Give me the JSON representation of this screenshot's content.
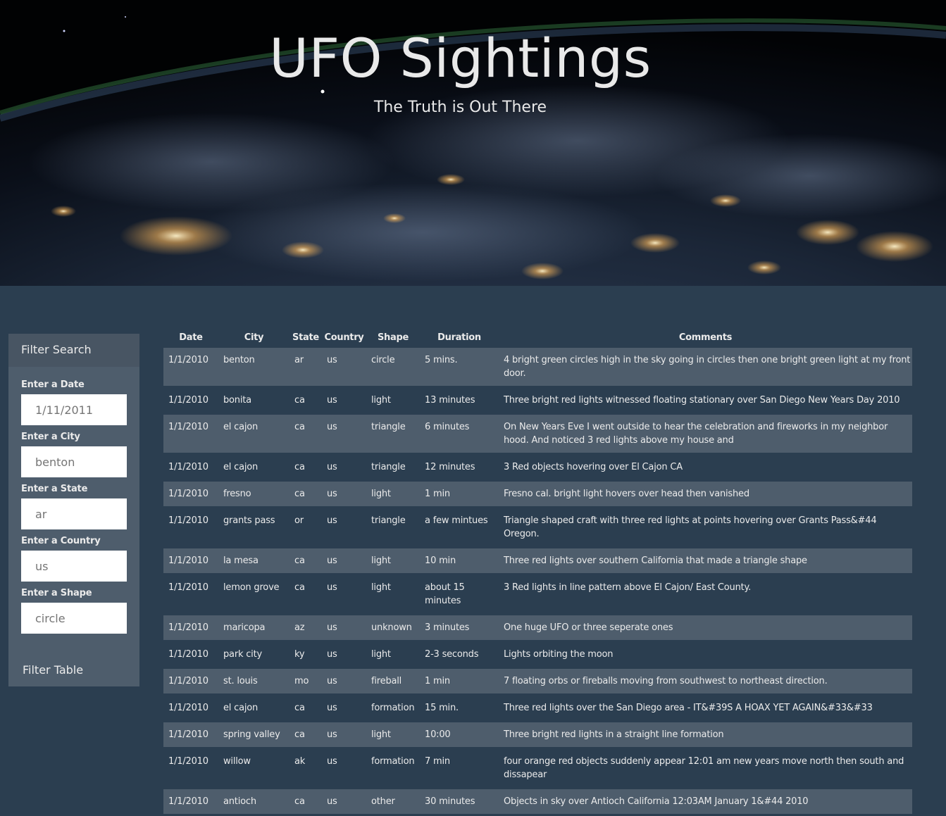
{
  "header": {
    "title": "UFO Sightings",
    "subtitle": "The Truth is Out There"
  },
  "filter": {
    "heading": "Filter Search",
    "fields": [
      {
        "label": "Enter a Date",
        "placeholder": "1/11/2011"
      },
      {
        "label": "Enter a City",
        "placeholder": "benton"
      },
      {
        "label": "Enter a State",
        "placeholder": "ar"
      },
      {
        "label": "Enter a Country",
        "placeholder": "us"
      },
      {
        "label": "Enter a Shape",
        "placeholder": "circle"
      }
    ],
    "button_label": "Filter Table"
  },
  "table": {
    "columns": [
      "Date",
      "City",
      "State",
      "Country",
      "Shape",
      "Duration",
      "Comments"
    ],
    "rows": [
      [
        "1/1/2010",
        "benton",
        "ar",
        "us",
        "circle",
        "5 mins.",
        "4 bright green circles high in the sky going in circles then one bright green light at my front door."
      ],
      [
        "1/1/2010",
        "bonita",
        "ca",
        "us",
        "light",
        "13 minutes",
        "Three bright red lights witnessed floating stationary over San Diego New Years Day 2010"
      ],
      [
        "1/1/2010",
        "el cajon",
        "ca",
        "us",
        "triangle",
        "6 minutes",
        "On New Years Eve I went outside to hear the celebration and fireworks in my neighbor hood. And noticed 3 red lights above my house and"
      ],
      [
        "1/1/2010",
        "el cajon",
        "ca",
        "us",
        "triangle",
        "12 minutes",
        "3 Red objects hovering over El Cajon CA"
      ],
      [
        "1/1/2010",
        "fresno",
        "ca",
        "us",
        "light",
        "1 min",
        "Fresno cal. bright light hovers over head then vanished"
      ],
      [
        "1/1/2010",
        "grants pass",
        "or",
        "us",
        "triangle",
        "a few mintues",
        "Triangle shaped craft with three red lights at points hovering over Grants Pass&#44 Oregon."
      ],
      [
        "1/1/2010",
        "la mesa",
        "ca",
        "us",
        "light",
        "10 min",
        "Three red lights over southern California that made a triangle shape"
      ],
      [
        "1/1/2010",
        "lemon grove",
        "ca",
        "us",
        "light",
        "about 15 minutes",
        "3 Red lights in line pattern above El Cajon/ East County."
      ],
      [
        "1/1/2010",
        "maricopa",
        "az",
        "us",
        "unknown",
        "3 minutes",
        "One huge UFO or three seperate ones"
      ],
      [
        "1/1/2010",
        "park city",
        "ky",
        "us",
        "light",
        "2-3 seconds",
        "Lights orbiting the moon"
      ],
      [
        "1/1/2010",
        "st. louis",
        "mo",
        "us",
        "fireball",
        "1 min",
        "7 floating orbs or fireballs moving from southwest to northeast direction."
      ],
      [
        "1/1/2010",
        "el cajon",
        "ca",
        "us",
        "formation",
        "15 min.",
        "Three red lights over the San Diego area - IT&#39S A HOAX YET AGAIN&#33&#33"
      ],
      [
        "1/1/2010",
        "spring valley",
        "ca",
        "us",
        "light",
        "10:00",
        "Three bright red lights in a straight line formation"
      ],
      [
        "1/1/2010",
        "willow",
        "ak",
        "us",
        "formation",
        "7 min",
        "four orange red objects suddenly appear 12:01 am new years move north then south and dissapear"
      ],
      [
        "1/1/2010",
        "antioch",
        "ca",
        "us",
        "other",
        "30 minutes",
        "Objects in sky over Antioch California 12:03AM January 1&#44 2010"
      ]
    ]
  }
}
